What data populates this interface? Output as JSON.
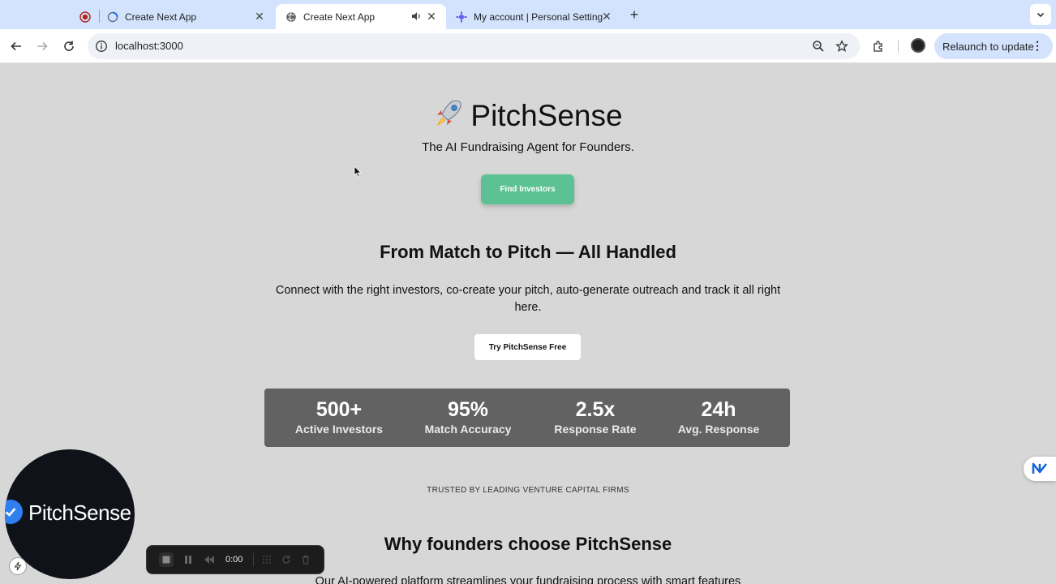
{
  "browser": {
    "tabs": [
      {
        "title": "",
        "icon": "record-icon",
        "active": false
      },
      {
        "title": "Create Next App",
        "icon": "loading-globe-icon",
        "active": false
      },
      {
        "title": "Create Next App",
        "icon": "globe-icon",
        "active": true,
        "audio": true
      },
      {
        "title": "My account | Personal Setting",
        "icon": "gear-favicon",
        "active": false
      }
    ],
    "url": "localhost:3000",
    "relaunch_label": "Relaunch to update"
  },
  "hero": {
    "title": "PitchSense",
    "subtitle": "The AI Fundraising Agent for Founders.",
    "cta_label": "Find Investors"
  },
  "section": {
    "title": "From Match to Pitch — All Handled",
    "description": "Connect with the right investors, co-create your pitch, auto-generate outreach and track it all right here.",
    "cta_label": "Try PitchSense Free"
  },
  "stats": [
    {
      "value": "500+",
      "label": "Active Investors"
    },
    {
      "value": "95%",
      "label": "Match Accuracy"
    },
    {
      "value": "2.5x",
      "label": "Response Rate"
    },
    {
      "value": "24h",
      "label": "Avg. Response"
    }
  ],
  "trusted_text": "TRUSTED BY LEADING VENTURE CAPITAL FIRMS",
  "why": {
    "title": "Why founders choose PitchSense",
    "description": "Our AI-powered platform streamlines your fundraising process with smart features"
  },
  "camera_overlay": {
    "label": "PitchSense"
  },
  "recorder": {
    "time": "0:00"
  },
  "colors": {
    "accent_green": "#5cc193",
    "stats_bg": "#626262",
    "tabbar_bg": "#d3e3fd",
    "page_bg": "#d7d7d7"
  }
}
